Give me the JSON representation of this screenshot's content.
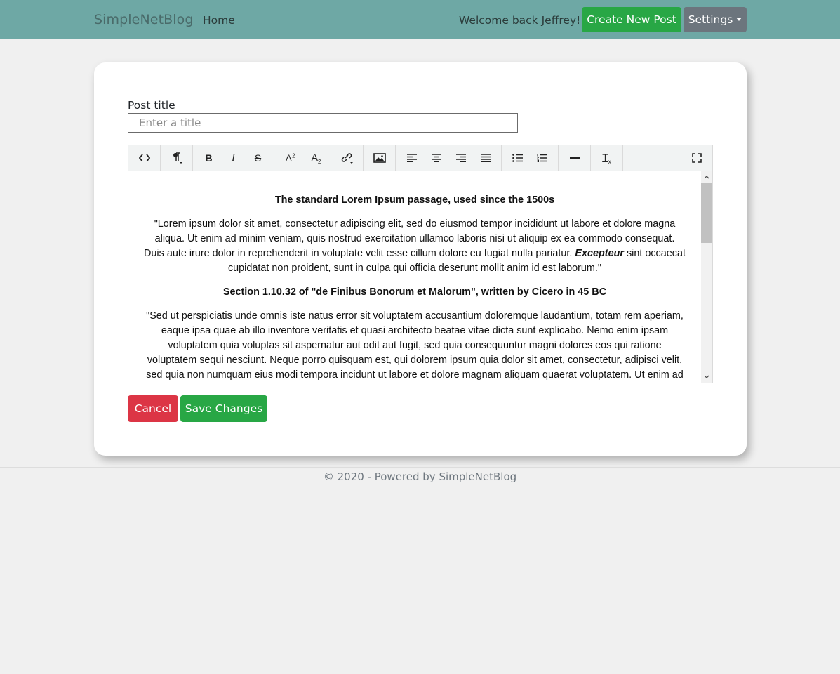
{
  "navbar": {
    "brand": "SimpleNetBlog",
    "home_link": "Home",
    "welcome_text": "Welcome back Jeffrey!",
    "create_button": "Create New Post",
    "settings_button": "Settings",
    "background_color": "#6ea8a5"
  },
  "form": {
    "title_label": "Post title",
    "title_placeholder": "Enter a title",
    "title_value": ""
  },
  "toolbar": {
    "buttons": [
      {
        "name": "code-view",
        "icon": "code-icon"
      },
      {
        "name": "paragraph-style",
        "icon": "pilcrow-icon"
      },
      {
        "name": "bold",
        "icon": "bold-icon"
      },
      {
        "name": "italic",
        "icon": "italic-icon"
      },
      {
        "name": "strikethrough",
        "icon": "strikethrough-icon"
      },
      {
        "name": "superscript",
        "icon": "superscript-icon"
      },
      {
        "name": "subscript",
        "icon": "subscript-icon"
      },
      {
        "name": "insert-link",
        "icon": "link-icon"
      },
      {
        "name": "insert-image",
        "icon": "image-icon"
      },
      {
        "name": "align-left",
        "icon": "align-left-icon"
      },
      {
        "name": "align-center",
        "icon": "align-center-icon"
      },
      {
        "name": "align-right",
        "icon": "align-right-icon"
      },
      {
        "name": "align-justify",
        "icon": "align-justify-icon"
      },
      {
        "name": "bullet-list",
        "icon": "bullet-list-icon"
      },
      {
        "name": "numbered-list",
        "icon": "numbered-list-icon"
      },
      {
        "name": "horizontal-rule",
        "icon": "horizontal-rule-icon"
      },
      {
        "name": "clear-formatting",
        "icon": "clear-format-icon"
      },
      {
        "name": "fullscreen",
        "icon": "fullscreen-icon"
      }
    ]
  },
  "editor": {
    "heading1": "The standard Lorem Ipsum passage, used since the 1500s",
    "para1_before": "\"Lorem ipsum dolor sit amet, consectetur adipiscing elit, sed do eiusmod tempor incididunt ut labore et dolore magna aliqua. Ut enim ad minim veniam, quis nostrud exercitation ullamco laboris nisi ut aliquip ex ea commodo consequat. Duis aute irure dolor in reprehenderit in voluptate velit esse cillum dolore eu fugiat nulla pariatur. ",
    "para1_emph": "Excepteur",
    "para1_after": " sint occaecat cupidatat non proident, sunt in culpa qui officia deserunt mollit anim id est laborum.\"",
    "heading2": "Section 1.10.32 of \"de Finibus Bonorum et Malorum\", written by Cicero in 45 BC",
    "para2": "\"Sed ut perspiciatis unde omnis iste natus error sit voluptatem accusantium doloremque laudantium, totam rem aperiam, eaque ipsa quae ab illo inventore veritatis et quasi architecto beatae vitae dicta sunt explicabo. Nemo enim ipsam voluptatem quia voluptas sit aspernatur aut odit aut fugit, sed quia consequuntur magni dolores eos qui ratione voluptatem sequi nesciunt. Neque porro quisquam est, qui dolorem ipsum quia dolor sit amet, consectetur, adipisci velit, sed quia non numquam eius modi tempora incidunt ut labore et dolore magnam aliquam quaerat voluptatem. Ut enim ad minima veniam,"
  },
  "actions": {
    "cancel_button": "Cancel",
    "save_button": "Save Changes",
    "cancel_color": "#dc3545",
    "save_color": "#28a745"
  },
  "footer": {
    "text": "© 2020 - Powered by SimpleNetBlog"
  }
}
